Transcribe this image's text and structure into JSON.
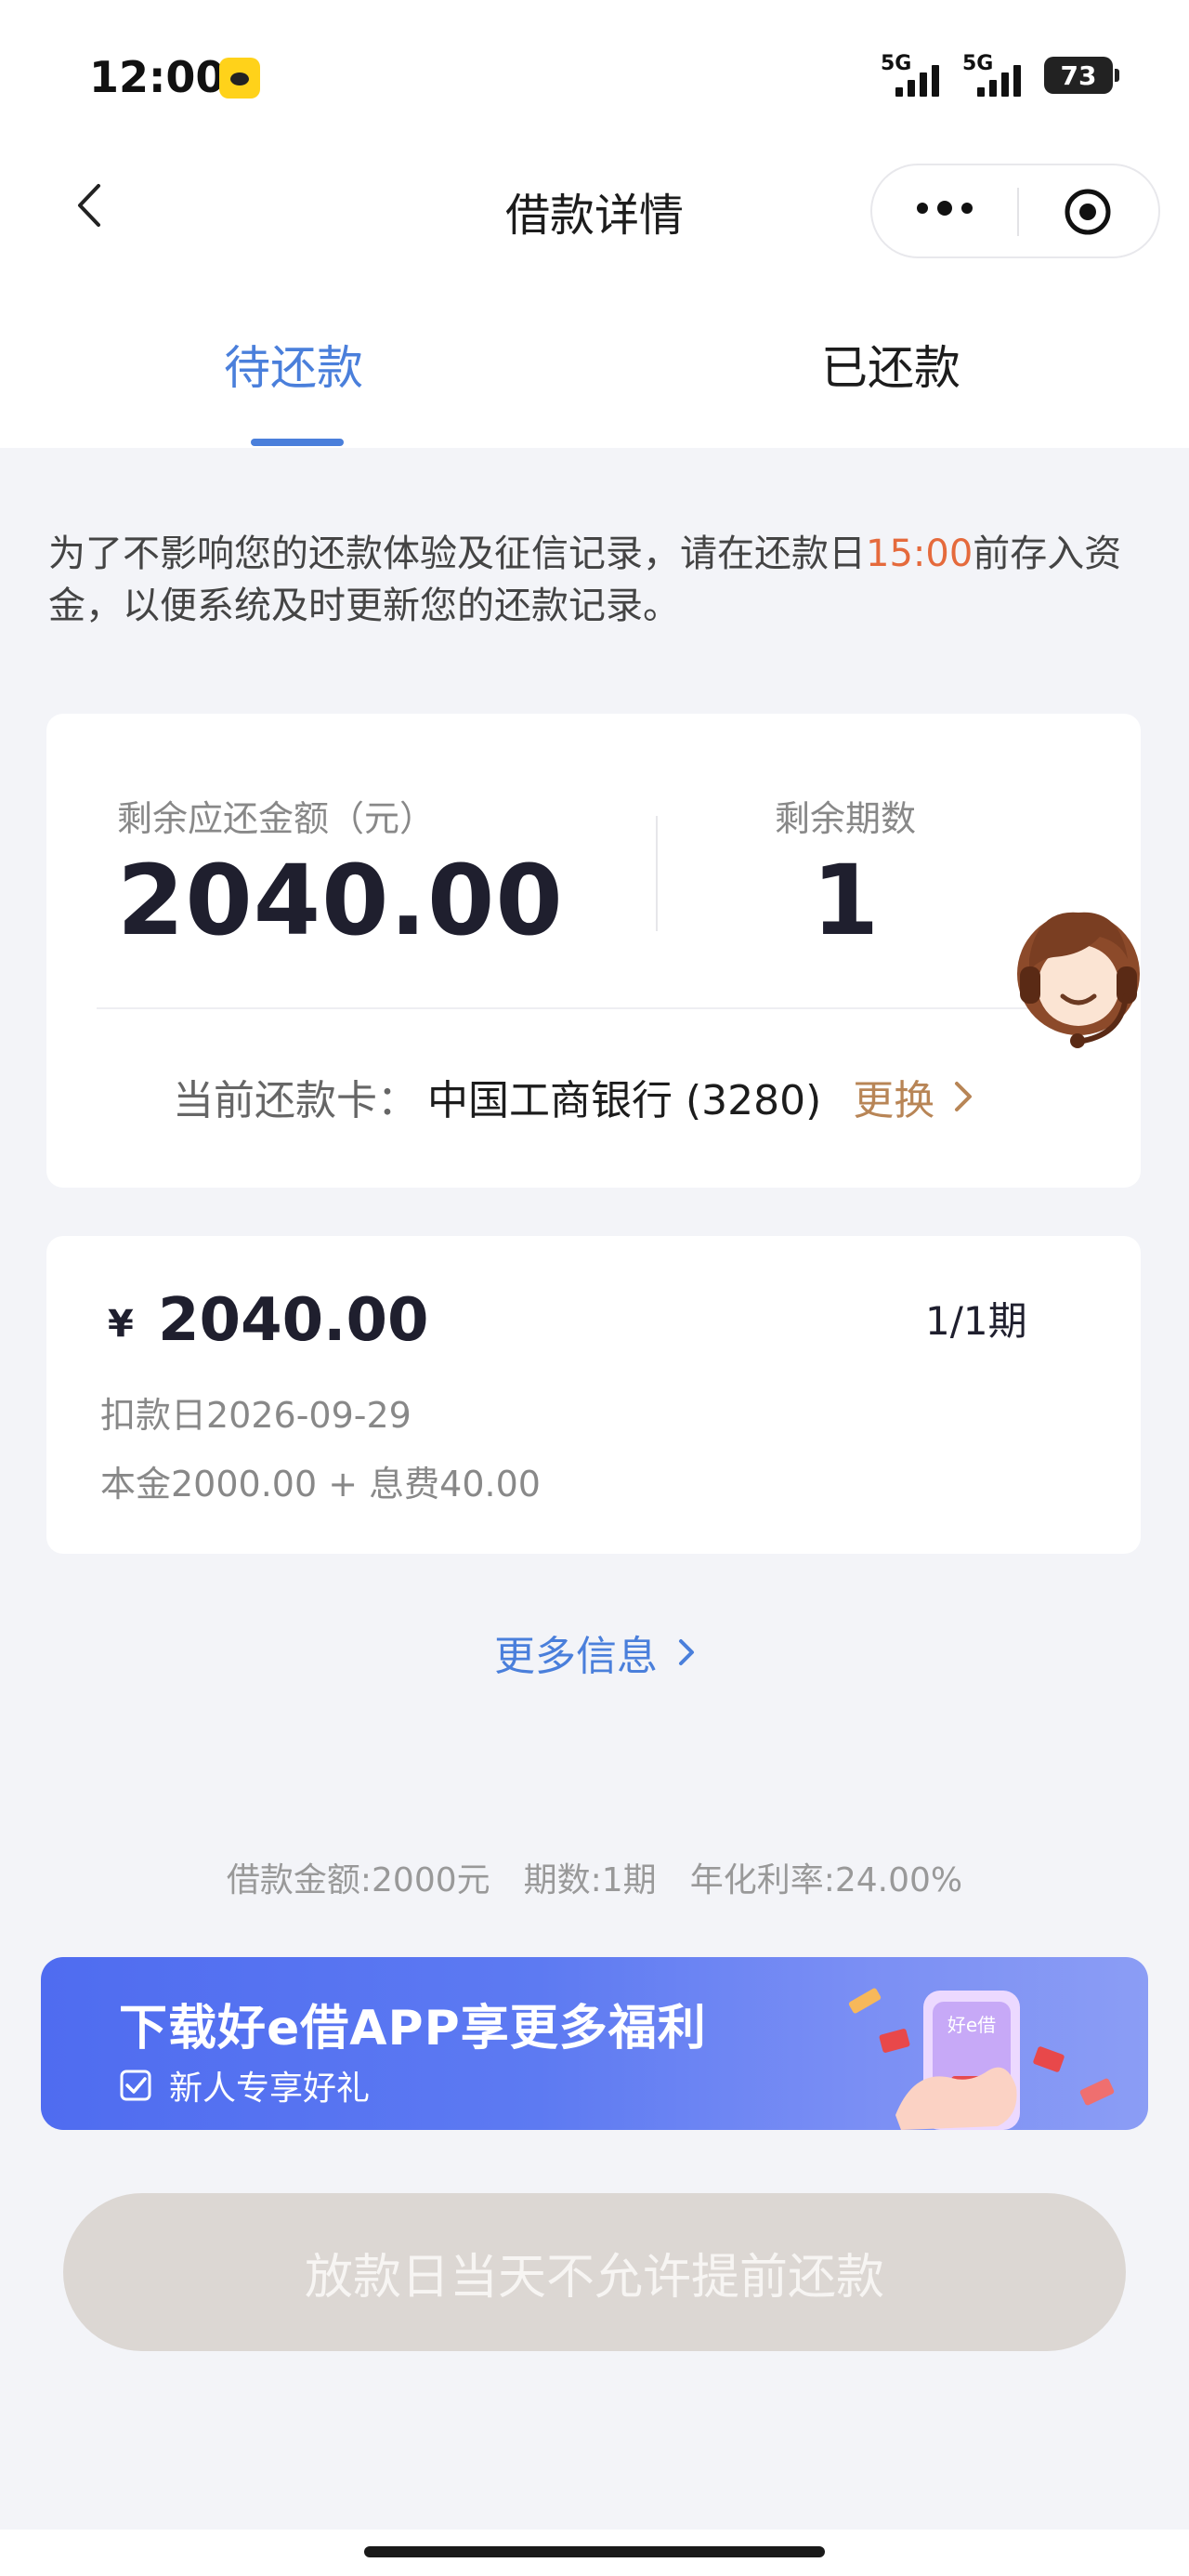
{
  "status_bar": {
    "time": "12:00",
    "network_1": "5G",
    "network_2": "5G",
    "battery": "73"
  },
  "nav": {
    "title": "借款详情"
  },
  "tabs": [
    {
      "label": "待还款",
      "active": true
    },
    {
      "label": "已还款",
      "active": false
    }
  ],
  "notice": {
    "before": "为了不影响您的还款体验及征信记录，请在还款日",
    "highlight": "15:00",
    "after": "前存入资金，以便系统及时更新您的还款记录。"
  },
  "summary": {
    "remaining_amount_label": "剩余应还金额（元）",
    "remaining_amount": "2040.00",
    "remaining_periods_label": "剩余期数",
    "remaining_periods": "1",
    "card_label": "当前还款卡：",
    "card_value": "中国工商银行 (3280)",
    "change_label": "更换"
  },
  "installment": {
    "currency": "¥",
    "amount": "2040.00",
    "period": "1/1期",
    "deduct_date": "扣款日2026-09-29",
    "breakdown": "本金2000.00 + 息费40.00"
  },
  "more_info": "更多信息",
  "loan_summary": {
    "amount": "借款金额:2000元",
    "periods": "期数:1期",
    "rate": "年化利率:24.00%"
  },
  "banner": {
    "title": "下载好e借APP享更多福利",
    "subtitle": "新人专享好礼",
    "phone_logo": "好e借"
  },
  "primary_button": "放款日当天不允许提前还款",
  "colors": {
    "accent_blue": "#4a7fdb",
    "highlight_orange": "#e56a3c",
    "change_link": "#b88556",
    "button_disabled": "#dcd7d3"
  },
  "icons": {
    "back": "chevron-left-icon",
    "more": "more-dots-icon",
    "close_miniprogram": "target-circle-icon",
    "change_arrow": "chevron-right-icon",
    "more_info_arrow": "chevron-right-icon",
    "customer_service": "headset-agent-icon",
    "banner_check": "checkbox-icon"
  }
}
